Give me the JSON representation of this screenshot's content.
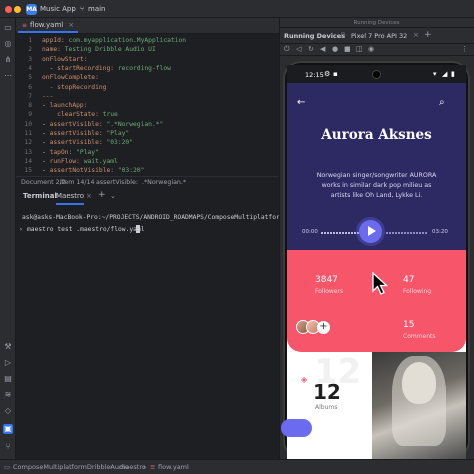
{
  "titlebar": {
    "app_badge": "MA",
    "app_name": "Music App",
    "branch": "main"
  },
  "editor": {
    "tab_label": "flow.yaml",
    "lines": [
      {
        "n": "1",
        "text": "appId: com.myapplication.MyApplication"
      },
      {
        "n": "2",
        "text": "name: Testing Dribble Audio UI"
      },
      {
        "n": "3",
        "text": "onFlowStart:"
      },
      {
        "n": "4",
        "text": "  - startRecording: recording-flow"
      },
      {
        "n": "5",
        "text": "onFlowComplete:"
      },
      {
        "n": "6",
        "text": "  - stopRecording"
      },
      {
        "n": "7",
        "text": "---"
      },
      {
        "n": "8",
        "text": "- launchApp:"
      },
      {
        "n": "9",
        "text": "    clearState: true"
      },
      {
        "n": "10",
        "text": "- assertVisible: \".*Norwegian.*\""
      },
      {
        "n": "11",
        "text": "- assertVisible: \"Play\""
      },
      {
        "n": "12",
        "text": "- assertVisible: \"03:20\""
      },
      {
        "n": "13",
        "text": "- tapOn: \"Play\""
      },
      {
        "n": "14",
        "text": "- runFlow: wait.yaml"
      },
      {
        "n": "15",
        "text": "- assertNotVisible: \"03:20\""
      }
    ],
    "breadcrumb": [
      "Document 2/2",
      "Item 14/14",
      "assertVisible:",
      ".*Norwegian.*"
    ]
  },
  "terminal": {
    "tabs": [
      "Terminal",
      "Maestro"
    ],
    "path_line": "ask@asks-MacBook-Pro:~/PROJECTS/ANDROID_ROADMAPS/ComposeMultiplatformDribb",
    "command": "maestro test .maestro/flow.yaml"
  },
  "devices_panel": {
    "header": "Running Devices",
    "tab_running": "Running Devices",
    "device_tab": "Pixel 7 Pro API 32"
  },
  "phone": {
    "time": "12:15",
    "artist": "Aurora Aksnes",
    "description": "Norwegian singer/songwriter AURORA works in similar dark pop milieu as artists like Oh Land, Lykke Li.",
    "time_start": "00:00",
    "time_end": "03:20",
    "followers_count": "3847",
    "followers_label": "Followers",
    "following_count": "47",
    "following_label": "Following",
    "comments_count": "15",
    "comments_label": "Comments",
    "albums_count": "12",
    "albums_label": "Albums",
    "add_symbol": "+",
    "accent_colors": {
      "hero": "#2d2a63",
      "stats": "#f7556a",
      "play": "#6b6bf0"
    }
  },
  "statusline": {
    "crumbs": [
      "ComposeMultiplatformDribbleAudio",
      ".maestro",
      "flow.yaml"
    ]
  },
  "icons": {
    "left_tools": [
      "folder-icon",
      "commit-icon",
      "structure-icon",
      "more-icon",
      "build-icon",
      "run-icon",
      "logcat-icon",
      "layers-icon",
      "problems-icon",
      "terminal-icon",
      "git-icon"
    ]
  }
}
